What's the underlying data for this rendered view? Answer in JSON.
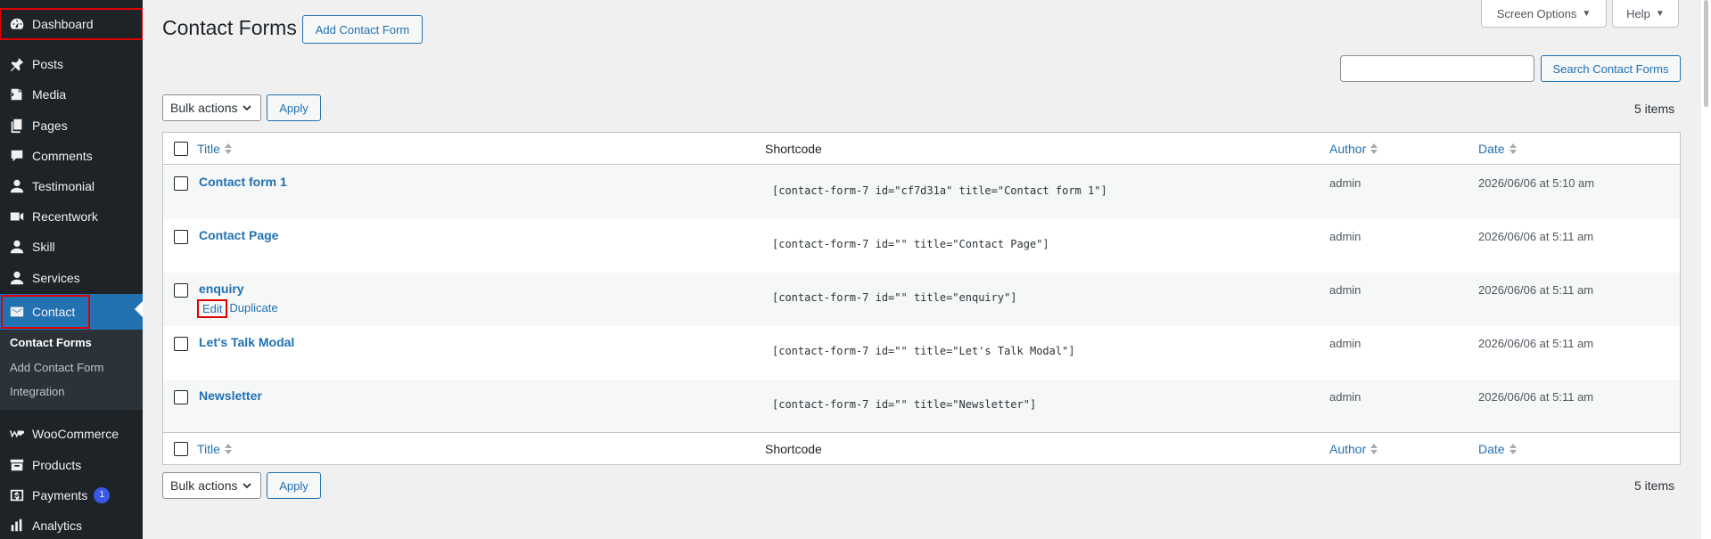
{
  "sidebar": {
    "items": [
      {
        "label": "Dashboard",
        "icon": "dashboard-icon"
      },
      {
        "label": "Posts",
        "icon": "pin-icon"
      },
      {
        "label": "Media",
        "icon": "media-icon"
      },
      {
        "label": "Pages",
        "icon": "pages-icon"
      },
      {
        "label": "Comments",
        "icon": "comment-icon"
      },
      {
        "label": "Testimonial",
        "icon": "user-icon"
      },
      {
        "label": "Recentwork",
        "icon": "video-icon"
      },
      {
        "label": "Skill",
        "icon": "user-icon"
      },
      {
        "label": "Services",
        "icon": "user-icon"
      },
      {
        "label": "Contact",
        "icon": "mail-icon"
      },
      {
        "label": "WooCommerce",
        "icon": "woo-icon"
      },
      {
        "label": "Products",
        "icon": "archive-icon"
      },
      {
        "label": "Payments",
        "icon": "dollar-icon",
        "badge": "1"
      },
      {
        "label": "Analytics",
        "icon": "chart-icon"
      }
    ],
    "submenu": [
      "Contact Forms",
      "Add Contact Form",
      "Integration"
    ]
  },
  "header": {
    "title": "Contact Forms",
    "add_button": "Add Contact Form",
    "screen_options": "Screen Options",
    "help": "Help",
    "search_button": "Search Contact Forms",
    "search_value": ""
  },
  "bulk": {
    "select_label": "Bulk actions",
    "apply": "Apply",
    "count": "5 items"
  },
  "table": {
    "columns": {
      "title": "Title",
      "shortcode": "Shortcode",
      "author": "Author",
      "date": "Date"
    },
    "rows": [
      {
        "title": "Contact form 1",
        "shortcode": "[contact-form-7 id=\"cf7d31a\" title=\"Contact form 1\"]",
        "author": "admin",
        "date": "2026/06/06 at 5:10 am"
      },
      {
        "title": "Contact Page",
        "shortcode": "[contact-form-7 id=\"\" title=\"Contact Page\"]",
        "author": "admin",
        "date": "2026/06/06 at 5:11 am"
      },
      {
        "title": "enquiry",
        "shortcode": "[contact-form-7 id=\"\" title=\"enquiry\"]",
        "author": "admin",
        "date": "2026/06/06 at 5:11 am"
      },
      {
        "title": "Let's Talk Modal",
        "shortcode": "[contact-form-7 id=\"\" title=\"Let's Talk Modal\"]",
        "author": "admin",
        "date": "2026/06/06 at 5:11 am"
      },
      {
        "title": "Newsletter",
        "shortcode": "[contact-form-7 id=\"\" title=\"Newsletter\"]",
        "author": "admin",
        "date": "2026/06/06 at 5:11 am"
      }
    ],
    "row_actions": {
      "edit": "Edit",
      "duplicate": "Duplicate"
    }
  },
  "colors": {
    "sidebar_bg": "#1d2327",
    "accent": "#2271b1",
    "highlight": "#e00000"
  }
}
